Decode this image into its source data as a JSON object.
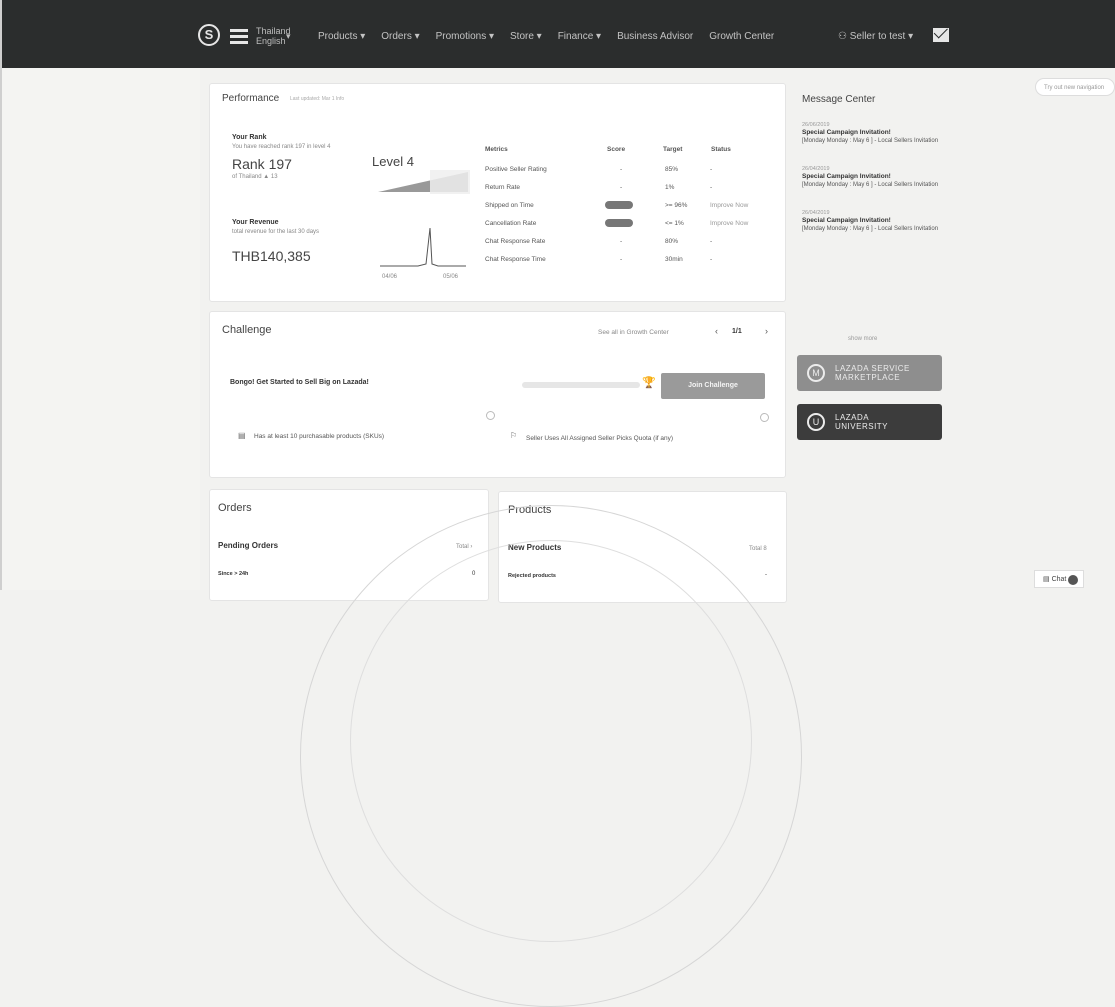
{
  "nav": {
    "logo": "S",
    "country_line1": "Thailand",
    "country_line2": "English",
    "items": [
      "Products ▾",
      "Orders ▾",
      "Promotions ▾",
      "Store ▾",
      "Finance ▾",
      "Business Advisor",
      "Growth Center"
    ],
    "user": "Seller to test ▾"
  },
  "search_placeholder": "Try out new navigation",
  "performance": {
    "title": "Performance",
    "subtitle": "Last updated: Mar 1   Info",
    "rank_title": "Your Rank",
    "rank_sub": "You have reached rank 197 in level 4",
    "rank_value": "Rank 197",
    "level": "Level 4",
    "rank_note": "of  Thailand  ▲ 13",
    "revenue_title": "Your Revenue",
    "revenue_sub": "total revenue for the last 30 days",
    "revenue_value": "THB140,385",
    "revenue_axis": [
      "04/06",
      "05/06"
    ],
    "metrics_headers": [
      "Metrics",
      "Score",
      "Target",
      "Status"
    ],
    "metrics": [
      {
        "name": "Positive Seller Rating",
        "score": "-",
        "target": "85%",
        "status": "-"
      },
      {
        "name": "Return Rate",
        "score": "-",
        "target": "1%",
        "status": "-"
      },
      {
        "name": "Shipped on Time",
        "score": "pill",
        "target": ">= 96%",
        "status": "Improve Now"
      },
      {
        "name": "Cancellation Rate",
        "score": "pill",
        "target": "<= 1%",
        "status": "Improve Now"
      },
      {
        "name": "Chat Response Rate",
        "score": "-",
        "target": "80%",
        "status": "-"
      },
      {
        "name": "Chat Response Time",
        "score": "-",
        "target": "30min",
        "status": "-"
      }
    ]
  },
  "challenge": {
    "title": "Challenge",
    "link": "See all in Growth Center",
    "pager": "1/1",
    "task": "Bongo! Get Started to Sell Big on Lazada!",
    "button": "Join Challenge",
    "req1": "Has at least 10 purchasable products (SKUs)",
    "req2": "Seller Uses All Assigned Seller Picks Quota (if any)"
  },
  "orders": {
    "title": "Orders",
    "section": "Pending Orders",
    "more": "Total ›",
    "row_label": "Since > 24h",
    "row_value": "0"
  },
  "products": {
    "title": "Products",
    "section": "New Products",
    "more": "Total 8",
    "row_label": "Rejected products",
    "row_value": "-"
  },
  "message_center": {
    "title": "Message Center",
    "items": [
      {
        "date": "26/06/2019",
        "title": "Special Campaign Invitation!",
        "body": "[Monday Monday : May 6 ] - Local Sellers Invitation"
      },
      {
        "date": "26/04/2019",
        "title": "Special Campaign Invitation!",
        "body": "[Monday Monday : May 6 ] - Local Sellers Invitation"
      },
      {
        "date": "26/04/2019",
        "title": "Special Campaign Invitation!",
        "body": "[Monday Monday : May 6 ] - Local Sellers Invitation"
      }
    ],
    "show_more": "show more"
  },
  "banners": [
    {
      "icon": "M",
      "line1": "LAZADA SERVICE",
      "line2": "MARKETPLACE"
    },
    {
      "icon": "U",
      "line1": "LAZADA",
      "line2": "UNIVERSITY"
    }
  ],
  "chat_label": "Chat"
}
